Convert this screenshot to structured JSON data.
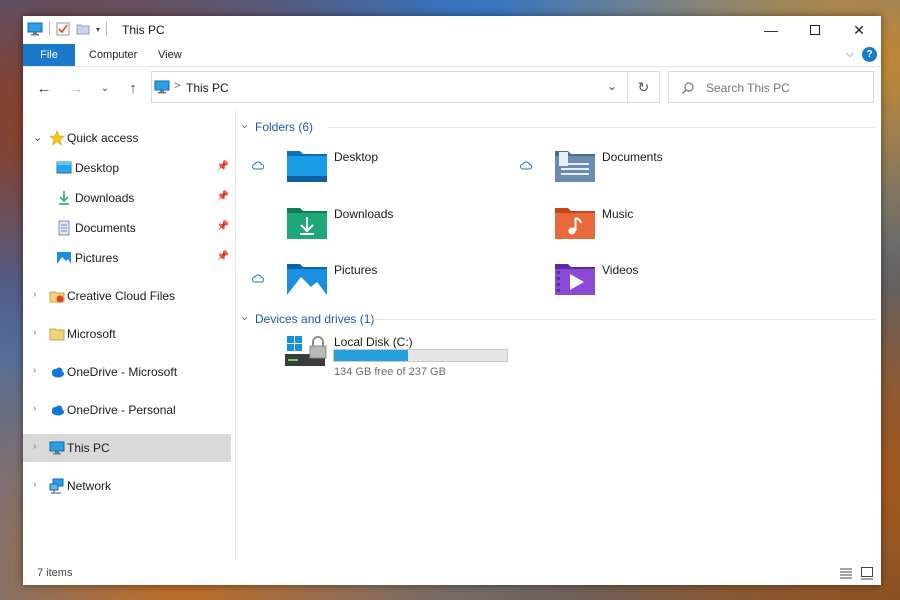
{
  "window": {
    "title": "This PC"
  },
  "ribbon": {
    "tabs": [
      "File",
      "Computer",
      "View"
    ],
    "help": "?"
  },
  "address": {
    "path": "This PC",
    "separator": ">"
  },
  "search": {
    "placeholder": "Search This PC"
  },
  "nav": {
    "items": [
      {
        "label": "Quick access",
        "icon": "star-icon",
        "expanded": true
      },
      {
        "label": "Desktop",
        "icon": "desktop-folder-icon",
        "pinned": true
      },
      {
        "label": "Downloads",
        "icon": "download-icon",
        "pinned": true
      },
      {
        "label": "Documents",
        "icon": "documents-icon",
        "pinned": true
      },
      {
        "label": "Pictures",
        "icon": "pictures-icon",
        "pinned": true
      },
      {
        "label": "Creative Cloud Files",
        "icon": "creative-cloud-icon"
      },
      {
        "label": "Microsoft",
        "icon": "folder-icon"
      },
      {
        "label": "OneDrive - Microsoft",
        "icon": "onedrive-icon"
      },
      {
        "label": "OneDrive - Personal",
        "icon": "onedrive-icon"
      },
      {
        "label": "This PC",
        "icon": "pc-icon",
        "selected": true
      },
      {
        "label": "Network",
        "icon": "network-icon"
      }
    ]
  },
  "folders": {
    "heading": "Folders (6)",
    "items": [
      {
        "name": "Desktop",
        "icon": "desktop-folder-icon",
        "cloud": true,
        "color": "#1a9be6"
      },
      {
        "name": "Documents",
        "icon": "documents-folder-icon",
        "cloud": true,
        "color": "#6c8bb0"
      },
      {
        "name": "Downloads",
        "icon": "downloads-folder-icon",
        "cloud": false,
        "color": "#1fa67a"
      },
      {
        "name": "Music",
        "icon": "music-folder-icon",
        "cloud": false,
        "color": "#e86a3a"
      },
      {
        "name": "Pictures",
        "icon": "pictures-folder-icon",
        "cloud": true,
        "color": "#1a8fe0"
      },
      {
        "name": "Videos",
        "icon": "videos-folder-icon",
        "cloud": false,
        "color": "#8a4ad6"
      }
    ]
  },
  "drives": {
    "heading": "Devices and drives (1)",
    "items": [
      {
        "name": "Local Disk (C:)",
        "free": "134 GB free of 237 GB",
        "used_fraction": 0.43,
        "bar_color": "#26a0da"
      }
    ]
  },
  "status": {
    "items": "7 items"
  },
  "colors": {
    "accent": "#1979ca",
    "selected": "#d9d9d9",
    "section": "#1d5aa8"
  }
}
